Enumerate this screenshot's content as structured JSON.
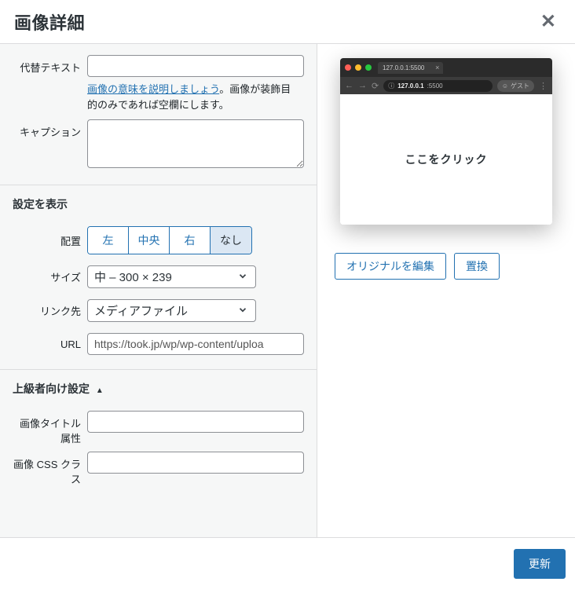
{
  "header": {
    "title": "画像詳細"
  },
  "fields": {
    "alt_label": "代替テキスト",
    "alt_help_link": "画像の意味を説明しましょう",
    "alt_help_rest": "。画像が装飾目的のみであれば空欄にします。",
    "caption_label": "キャプション"
  },
  "display": {
    "section_label": "設定を表示",
    "align_label": "配置",
    "align_options": {
      "left": "左",
      "center": "中央",
      "right": "右",
      "none": "なし"
    },
    "align_selected": "none",
    "size_label": "サイズ",
    "size_value": "中 – 300 × 239",
    "link_label": "リンク先",
    "link_value": "メディアファイル",
    "url_label": "URL",
    "url_value": "https://took.jp/wp/wp-content/uploa"
  },
  "advanced": {
    "section_label": "上級者向け設定",
    "title_attr_label": "画像タイトル属性",
    "css_class_label": "画像 CSS クラス"
  },
  "preview": {
    "tab_addr": "127.0.0.1:5500",
    "addr_info": "127.0.0.1",
    "addr_port": ":5500",
    "guest_label": "ゲスト",
    "content_text": "ここをクリック",
    "edit_btn": "オリジナルを編集",
    "replace_btn": "置換"
  },
  "footer": {
    "update_btn": "更新"
  }
}
